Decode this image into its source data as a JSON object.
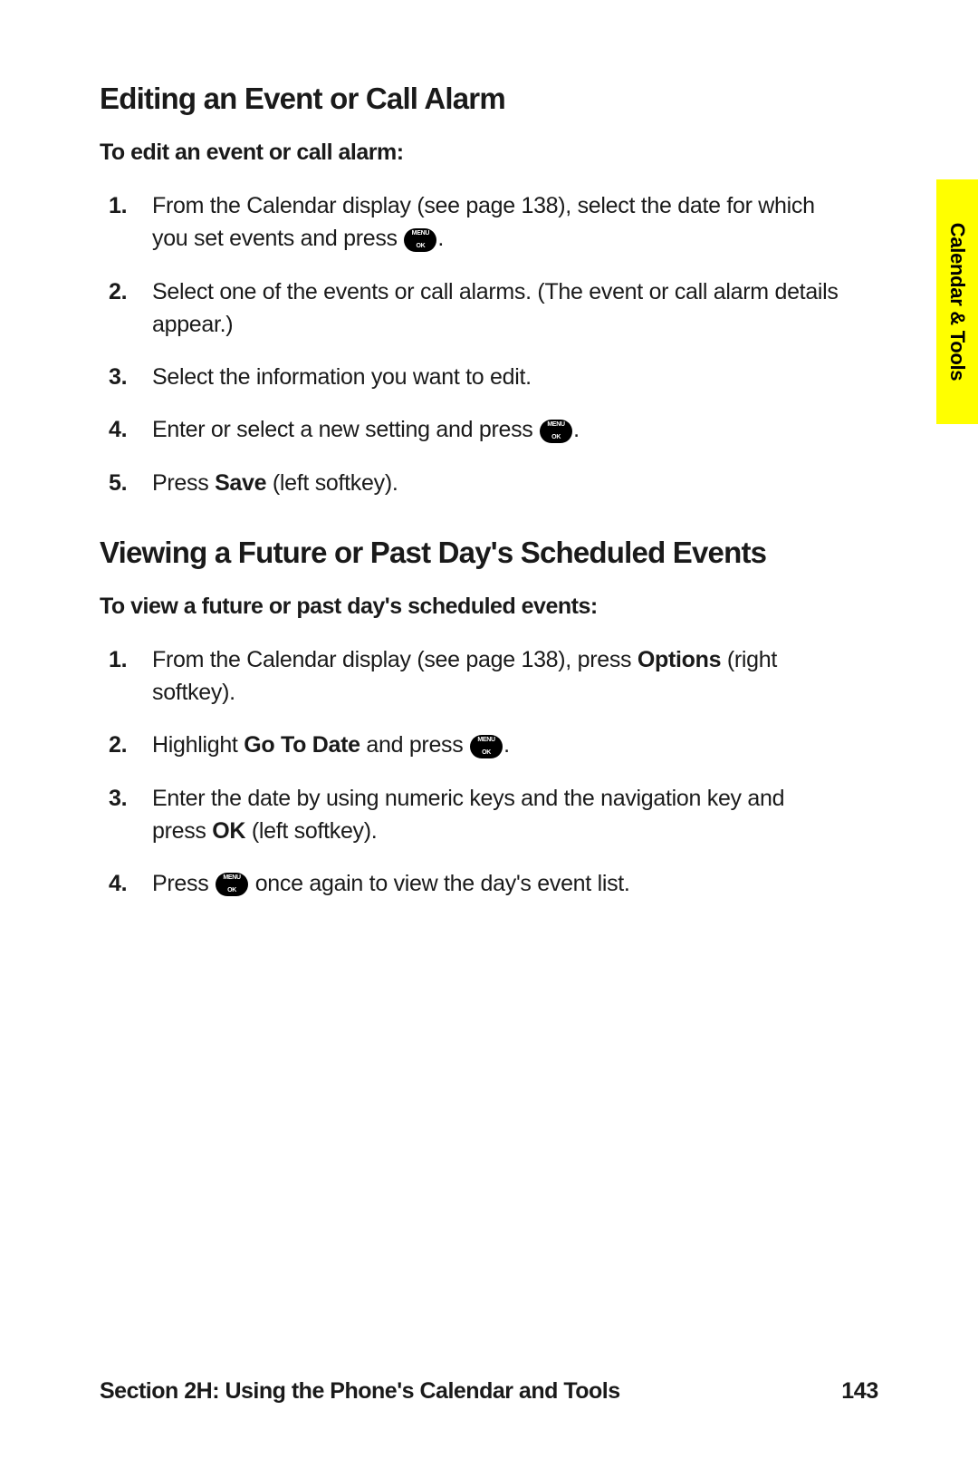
{
  "section1": {
    "heading": "Editing an Event or Call Alarm",
    "subhead": "To edit an event or call alarm:",
    "items": [
      {
        "num": "1.",
        "pre": "From the Calendar display (see page 138), select the date for which you set events and press ",
        "icon": true,
        "post": "."
      },
      {
        "num": "2.",
        "text": "Select one of the events or call alarms. (The event or call alarm details appear.)"
      },
      {
        "num": "3.",
        "text": "Select the information you want to edit."
      },
      {
        "num": "4.",
        "pre": "Enter or select a new setting and press ",
        "icon": true,
        "post": "."
      },
      {
        "num": "5.",
        "pre": "Press ",
        "bold": "Save",
        "post": " (left softkey)."
      }
    ]
  },
  "section2": {
    "heading": "Viewing a Future or Past Day's Scheduled Events",
    "subhead": "To view a future or past day's scheduled events:",
    "items": [
      {
        "num": "1.",
        "pre": "From the Calendar display (see page 138), press ",
        "bold": "Options",
        "post": " (right softkey)."
      },
      {
        "num": "2.",
        "pre": "Highlight ",
        "bold": "Go To Date",
        "mid": " and press ",
        "icon": true,
        "post": "."
      },
      {
        "num": "3.",
        "pre": "Enter the date by using numeric keys and the navigation key and press ",
        "bold": "OK",
        "post": " (left softkey)."
      },
      {
        "num": "4.",
        "pre": "Press ",
        "icon": true,
        "post": " once again to view the day's event list."
      }
    ]
  },
  "sidetab": "Calendar & Tools",
  "footer": {
    "title": "Section 2H: Using the Phone's Calendar and Tools",
    "page": "143"
  }
}
